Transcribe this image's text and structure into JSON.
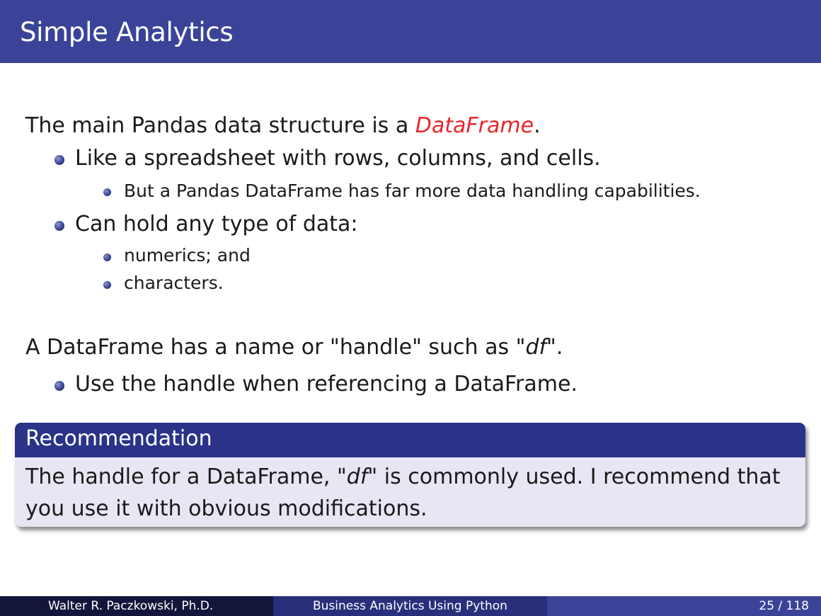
{
  "slide": {
    "title": "Simple Analytics"
  },
  "body": {
    "p1_prefix": "The main Pandas data structure is a ",
    "p1_term": "DataFrame",
    "p1_suffix": ".",
    "b1": "Like a spreadsheet with rows, columns, and cells.",
    "b1_sub1": "But a Pandas DataFrame has far more data handling capabilities.",
    "b2": "Can hold any type of data:",
    "b2_sub1": "numerics; and",
    "b2_sub2": "characters.",
    "p2_prefix": "A DataFrame has a name or \"handle\" such as \"",
    "p2_term": "df",
    "p2_suffix": "\".",
    "b3": "Use the handle when referencing a DataFrame."
  },
  "recommendation": {
    "title": "Recommendation",
    "line1_prefix": "The handle for a DataFrame, \"",
    "line1_term": "df",
    "line1_suffix": "\" is commonly used. I recommend that",
    "line2": "you use it with obvious modifications."
  },
  "footer": {
    "author": "Walter R. Paczkowski, Ph.D.",
    "course": "Business Analytics Using Python",
    "page": "25 / 118"
  },
  "colors": {
    "title_bar": "#3b4399",
    "highlight": "#e8262a",
    "block_header": "#2b3388",
    "block_body": "#e6e7f2"
  }
}
